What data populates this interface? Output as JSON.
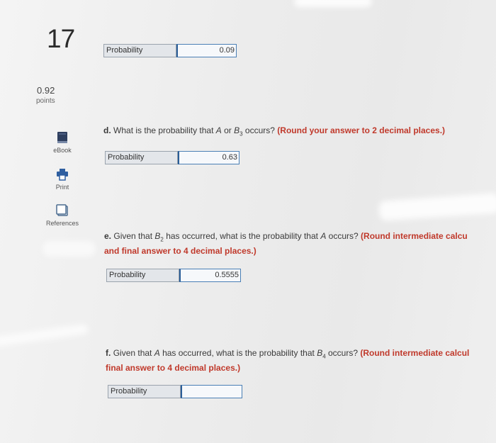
{
  "question": {
    "number": "17",
    "points_value": "0.92",
    "points_label": "points"
  },
  "tools": [
    {
      "label": "eBook",
      "icon": "book-icon"
    },
    {
      "label": "Print",
      "icon": "printer-icon"
    },
    {
      "label": "References",
      "icon": "references-icon"
    }
  ],
  "answers": {
    "c": {
      "label": "Probability",
      "value": "0.09"
    },
    "d": {
      "label": "Probability",
      "value": "0.63"
    },
    "e": {
      "label": "Probability",
      "value": "0.5555"
    },
    "f": {
      "label": "Probability",
      "value": ""
    }
  },
  "prompts": {
    "d": {
      "letter": "d.",
      "text1": "What is the probability that ",
      "a": "A",
      "or": " or ",
      "b": "B",
      "sub": "3",
      "text2": " occurs?",
      "hint": "(Round your answer to 2 decimal places.)"
    },
    "e": {
      "letter": "e.",
      "text1": "Given that ",
      "b": "B",
      "sub": "2",
      "text2": " has occurred, what is the probability that ",
      "a": "A",
      "text3": " occurs?",
      "hint1": "(Round intermediate calcu",
      "hint2": "and final answer to 4 decimal places.)"
    },
    "f": {
      "letter": "f.",
      "text1": "Given that ",
      "a": "A",
      "text2": " has occurred, what is the probability that ",
      "b": "B",
      "sub": "4",
      "text3": " occurs?",
      "hint1": "(Round intermediate calcul",
      "hint2": "final answer to 4 decimal places.)"
    }
  },
  "colors": {
    "hint": "#c0392b",
    "input_border": "#4a7fb5",
    "label_bg": "#e3e6ea",
    "ebook_icon": "#2f3f5f",
    "print_icon": "#2f5fa0"
  }
}
